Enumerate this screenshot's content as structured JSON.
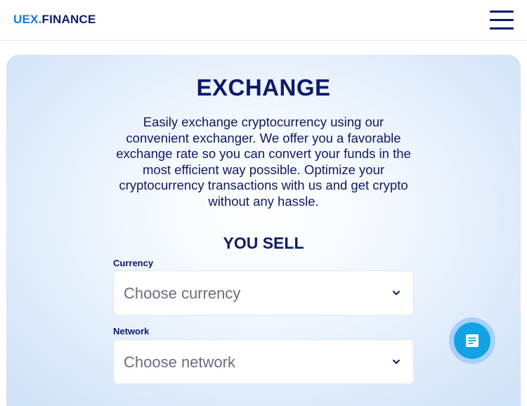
{
  "header": {
    "logo_part1": "UEX.",
    "logo_part2": "FINANCE",
    "menu_icon": "hamburger-menu-icon"
  },
  "main": {
    "title": "EXCHANGE",
    "description": "Easily exchange cryptocurrency using our convenient exchanger. We offer you a favorable exchange rate so you can convert your funds in the most efficient way possible. Optimize your cryptocurrency transactions with us and get crypto without any hassle.",
    "sell_title": "YOU SELL",
    "currency": {
      "label": "Currency",
      "placeholder": "Choose currency",
      "icon": "chevron-down-icon"
    },
    "network": {
      "label": "Network",
      "placeholder": "Choose network",
      "icon": "chevron-down-icon"
    }
  },
  "chat": {
    "icon": "chat-icon"
  },
  "colors": {
    "brand_blue": "#1976e8",
    "navy": "#0d1a6e",
    "chat_blue": "#12a2e6"
  }
}
